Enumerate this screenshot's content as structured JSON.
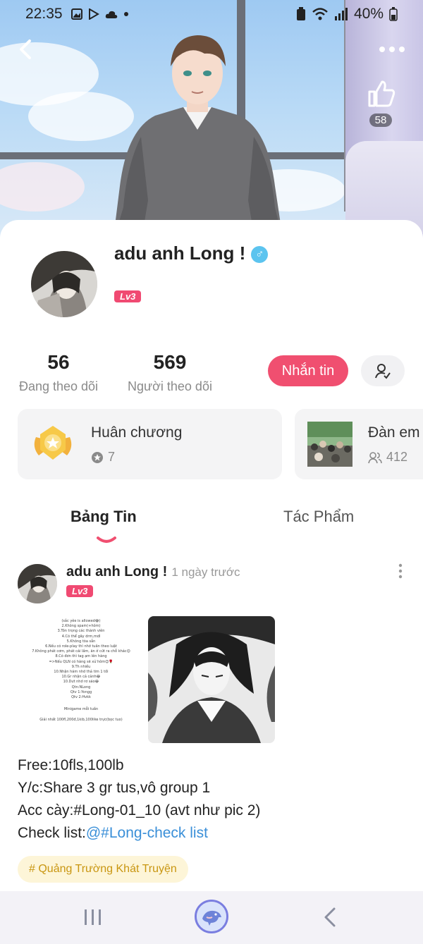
{
  "status_bar": {
    "time": "22:35",
    "battery": "40%"
  },
  "header": {
    "like_count": "58"
  },
  "profile": {
    "username": "adu anh Long !",
    "gender_symbol": "♂",
    "level": "Lv3",
    "following_count": "56",
    "following_label": "Đang theo dõi",
    "followers_count": "569",
    "followers_label": "Người theo dõi",
    "message_button": "Nhắn tin"
  },
  "tiles": [
    {
      "title": "Huân chương",
      "count": "7",
      "icon": "medal-icon"
    },
    {
      "title": "Đàn em",
      "count": "412",
      "icon": "group-photo"
    }
  ],
  "tabs": [
    {
      "label": "Bảng Tin",
      "active": true
    },
    {
      "label": "Tác Phẩm",
      "active": false
    }
  ],
  "post": {
    "author": "adu anh Long !",
    "time": "1 ngày trước",
    "level": "Lv3",
    "rules_image_lines": [
      "(sắc yêe is allowed😂)",
      "2.Không spam(+hôm)",
      "3.Tôn trọng các thành viên",
      "4.Có thể gây drm,mdl",
      "5.Không tòa sẵn",
      "6.Nếu có role-play thì nhớ tuân theo luật",
      "7.Không phát cơm, phát cái lầm, ăn ở cứt ra chỗ khác😊",
      "8.Có đơn thì tag ạm lên hàng",
      "=>Nếu QLN có hàng sẽ xử hôm😊🌹",
      "9.Th nhiều",
      "10.Nhận hám nhớ thả tim 1 tối",
      "10.Gr nhận cả cảnh😂",
      "10.Dưt nhớ rơ sáo😂",
      "Qtn:NLong",
      "Qtv 1:Yongg",
      "Qtv 2:Hvkk",
      "Minigame mỗi tuần",
      "Giải nhất 100fl,200đ,1kib,100like trực(bọc tuo)"
    ],
    "body_lines": [
      "Free:10fls,100lb",
      "Y/c:Share 3 gr  tus,vô group 1",
      "Acc cày:#Long-01_10 (avt như pic 2)"
    ],
    "check_prefix": "Check list:",
    "check_link": "@#Long-check list",
    "hashtag": "# Quảng Trường Khát Truyện"
  },
  "colors": {
    "accent_pink": "#f04f70",
    "link_blue": "#3a8fd8",
    "hashtag_gold": "#c99611"
  }
}
